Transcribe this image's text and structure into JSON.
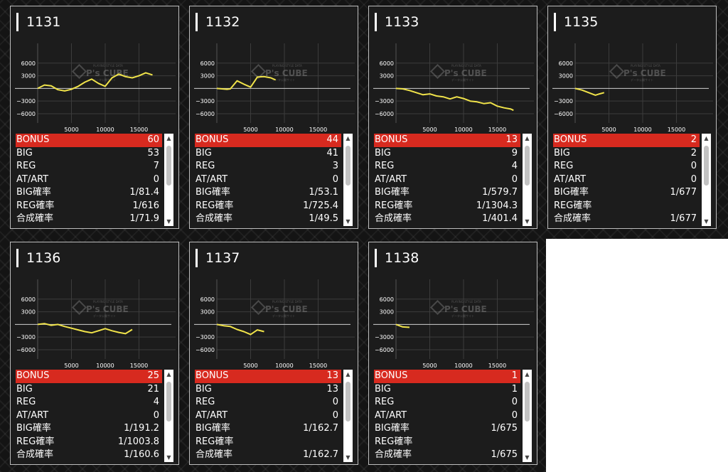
{
  "machines": [
    {
      "title": "1131",
      "stats": [
        {
          "label": "BONUS",
          "value": "60"
        },
        {
          "label": "BIG",
          "value": "53"
        },
        {
          "label": "REG",
          "value": "7"
        },
        {
          "label": "AT/ART",
          "value": "0"
        },
        {
          "label": "BIG確率",
          "value": "1/81.4"
        },
        {
          "label": "REG確率",
          "value": "1/616"
        },
        {
          "label": "合成確率",
          "value": "1/71.9"
        }
      ],
      "chart_data": {
        "type": "line",
        "x": [
          0,
          1000,
          2000,
          3000,
          4000,
          5000,
          6000,
          7000,
          8000,
          9000,
          10000,
          11000,
          12000,
          13000,
          14000,
          15000,
          16000,
          17000
        ],
        "y": [
          0,
          800,
          600,
          -300,
          -600,
          -200,
          500,
          1500,
          2200,
          1200,
          500,
          2500,
          3400,
          2800,
          2500,
          3000,
          3700,
          3200
        ],
        "yticks": [
          6000,
          3000,
          -3000,
          -6000
        ],
        "xticks": [
          5000,
          10000,
          15000
        ],
        "ylim": [
          -8200,
          9000
        ],
        "xlim": [
          0,
          20000
        ]
      }
    },
    {
      "title": "1132",
      "stats": [
        {
          "label": "BONUS",
          "value": "44"
        },
        {
          "label": "BIG",
          "value": "41"
        },
        {
          "label": "REG",
          "value": "3"
        },
        {
          "label": "AT/ART",
          "value": "0"
        },
        {
          "label": "BIG確率",
          "value": "1/53.1"
        },
        {
          "label": "REG確率",
          "value": "1/725.4"
        },
        {
          "label": "合成確率",
          "value": "1/49.5"
        }
      ],
      "chart_data": {
        "type": "line",
        "x": [
          0,
          1500,
          2000,
          3000,
          4000,
          5000,
          6000,
          7000,
          8000,
          8700
        ],
        "y": [
          0,
          -200,
          -100,
          1800,
          1000,
          300,
          2700,
          2800,
          2500,
          2000
        ],
        "yticks": [
          6000,
          3000,
          -3000,
          -6000
        ],
        "xticks": [
          5000,
          10000,
          15000
        ],
        "ylim": [
          -8200,
          9000
        ],
        "xlim": [
          0,
          20000
        ]
      }
    },
    {
      "title": "1133",
      "stats": [
        {
          "label": "BONUS",
          "value": "13"
        },
        {
          "label": "BIG",
          "value": "9"
        },
        {
          "label": "REG",
          "value": "4"
        },
        {
          "label": "AT/ART",
          "value": "0"
        },
        {
          "label": "BIG確率",
          "value": "1/579.7"
        },
        {
          "label": "REG確率",
          "value": "1/1304.3"
        },
        {
          "label": "合成確率",
          "value": "1/401.4"
        }
      ],
      "chart_data": {
        "type": "line",
        "x": [
          0,
          1000,
          2000,
          3000,
          4000,
          5000,
          6000,
          7000,
          8000,
          9000,
          10000,
          11000,
          12000,
          13000,
          14000,
          15000,
          16000,
          17000,
          17400
        ],
        "y": [
          0,
          -100,
          -500,
          -1000,
          -1500,
          -1300,
          -1800,
          -2000,
          -2500,
          -2000,
          -2400,
          -3000,
          -3200,
          -3600,
          -3400,
          -4200,
          -4600,
          -4900,
          -5200
        ],
        "yticks": [
          6000,
          3000,
          -3000,
          -6000
        ],
        "xticks": [
          5000,
          10000,
          15000
        ],
        "ylim": [
          -8200,
          9000
        ],
        "xlim": [
          0,
          20000
        ]
      }
    },
    {
      "title": "1135",
      "stats": [
        {
          "label": "BONUS",
          "value": "2"
        },
        {
          "label": "BIG",
          "value": "2"
        },
        {
          "label": "REG",
          "value": "0"
        },
        {
          "label": "AT/ART",
          "value": "0"
        },
        {
          "label": "BIG確率",
          "value": "1/677"
        },
        {
          "label": "REG確率",
          "value": ""
        },
        {
          "label": "合成確率",
          "value": "1/677"
        }
      ],
      "chart_data": {
        "type": "line",
        "x": [
          0,
          1000,
          2000,
          3000,
          3600,
          4300
        ],
        "y": [
          0,
          -400,
          -1000,
          -1600,
          -1300,
          -1000
        ],
        "yticks": [
          6000,
          3000,
          -3000,
          -6000
        ],
        "xticks": [
          5000,
          10000,
          15000
        ],
        "ylim": [
          -8200,
          9000
        ],
        "xlim": [
          0,
          20000
        ]
      }
    },
    {
      "title": "1136",
      "stats": [
        {
          "label": "BONUS",
          "value": "25"
        },
        {
          "label": "BIG",
          "value": "21"
        },
        {
          "label": "REG",
          "value": "4"
        },
        {
          "label": "AT/ART",
          "value": "0"
        },
        {
          "label": "BIG確率",
          "value": "1/191.2"
        },
        {
          "label": "REG確率",
          "value": "1/1003.8"
        },
        {
          "label": "合成確率",
          "value": "1/160.6"
        }
      ],
      "chart_data": {
        "type": "line",
        "x": [
          0,
          1000,
          2000,
          3000,
          4000,
          5000,
          6000,
          7000,
          8000,
          9000,
          10000,
          11000,
          12000,
          13000,
          14000
        ],
        "y": [
          0,
          200,
          -200,
          0,
          -500,
          -900,
          -1300,
          -1700,
          -2000,
          -1500,
          -1000,
          -1500,
          -1900,
          -2200,
          -1200
        ],
        "yticks": [
          6000,
          3000,
          -3000,
          -6000
        ],
        "xticks": [
          5000,
          10000,
          15000
        ],
        "ylim": [
          -8200,
          9000
        ],
        "xlim": [
          0,
          20000
        ]
      }
    },
    {
      "title": "1137",
      "stats": [
        {
          "label": "BONUS",
          "value": "13"
        },
        {
          "label": "BIG",
          "value": "13"
        },
        {
          "label": "REG",
          "value": "0"
        },
        {
          "label": "AT/ART",
          "value": "0"
        },
        {
          "label": "BIG確率",
          "value": "1/162.7"
        },
        {
          "label": "REG確率",
          "value": ""
        },
        {
          "label": "合成確率",
          "value": "1/162.7"
        }
      ],
      "chart_data": {
        "type": "line",
        "x": [
          0,
          1000,
          2000,
          3000,
          4000,
          5000,
          6000,
          7000
        ],
        "y": [
          0,
          -300,
          -500,
          -1200,
          -1700,
          -2400,
          -1300,
          -1700
        ],
        "yticks": [
          6000,
          3000,
          -3000,
          -6000
        ],
        "xticks": [
          5000,
          10000,
          15000
        ],
        "ylim": [
          -8200,
          9000
        ],
        "xlim": [
          0,
          20000
        ]
      }
    },
    {
      "title": "1138",
      "stats": [
        {
          "label": "BONUS",
          "value": "1"
        },
        {
          "label": "BIG",
          "value": "1"
        },
        {
          "label": "REG",
          "value": "0"
        },
        {
          "label": "AT/ART",
          "value": "0"
        },
        {
          "label": "BIG確率",
          "value": "1/675"
        },
        {
          "label": "REG確率",
          "value": ""
        },
        {
          "label": "合成確率",
          "value": "1/675"
        }
      ],
      "chart_data": {
        "type": "line",
        "x": [
          0,
          1000,
          2000
        ],
        "y": [
          0,
          -600,
          -700
        ],
        "yticks": [
          6000,
          3000,
          -3000,
          -6000
        ],
        "xticks": [
          5000,
          10000,
          15000
        ],
        "ylim": [
          -8200,
          9000
        ],
        "xlim": [
          0,
          20000
        ]
      }
    }
  ],
  "watermark": {
    "brand": "P's CUBE",
    "caption": "PLAYING STYLE DATA",
    "subcaption": "データ公開サイト"
  },
  "scrollbar": {
    "up": "▲",
    "down": "▼"
  },
  "colors": {
    "line": "#f0e34a",
    "highlight": "#d72a1f",
    "panel": "#1c1c1c",
    "border": "#bdbdbd"
  }
}
